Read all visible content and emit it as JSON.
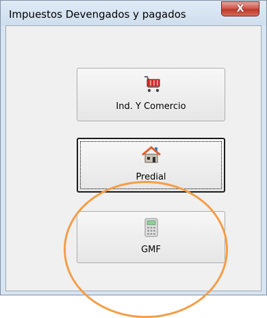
{
  "window": {
    "title": "Impuestos Devengados y pagados",
    "close_label": "X"
  },
  "buttons": [
    {
      "label": "Ind. Y Comercio",
      "icon": "shopping-cart-icon"
    },
    {
      "label": "Predial",
      "icon": "house-icon"
    },
    {
      "label": "GMF",
      "icon": "calculator-icon"
    }
  ],
  "colors": {
    "annotation_circle": "#f59d45",
    "client_background": "#f0f0f0",
    "titlebar": "#d7e4f2",
    "close_button": "#c94b3c"
  }
}
